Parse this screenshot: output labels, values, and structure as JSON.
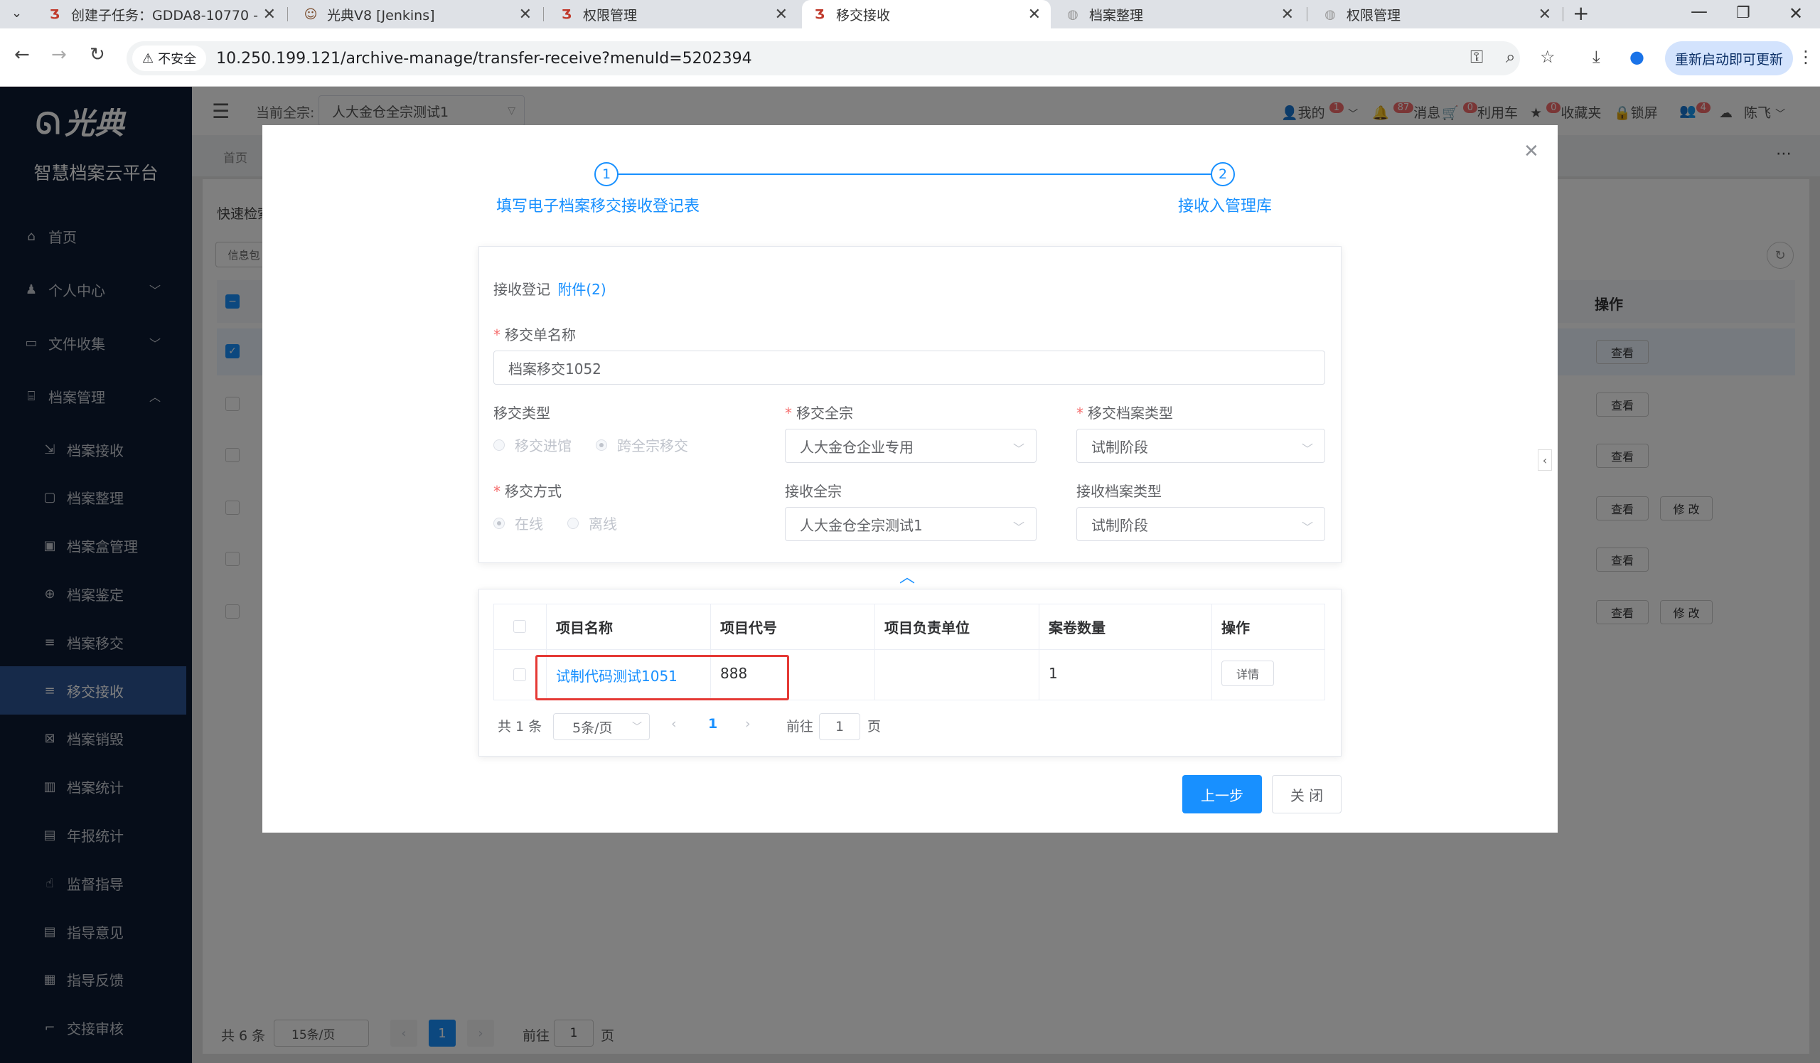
{
  "browser": {
    "tabs": [
      {
        "title": "创建子任务：GDDA8-10770 -",
        "icon": "lightning-icon"
      },
      {
        "title": "光典V8 [Jenkins]",
        "icon": "jenkins-icon"
      },
      {
        "title": "权限管理",
        "icon": "lightning-icon"
      },
      {
        "title": "移交接收",
        "icon": "lightning-icon",
        "active": true
      },
      {
        "title": "档案整理",
        "icon": "globe-icon"
      },
      {
        "title": "权限管理",
        "icon": "globe-icon"
      }
    ],
    "security_label": "不安全",
    "url": "10.250.199.121/archive-manage/transfer-receive?menuId=5202394",
    "relaunch_label": "重新启动即可更新"
  },
  "sidebar": {
    "logo": "光典",
    "platform": "智慧档案云平台",
    "items": [
      {
        "label": "首页",
        "icon": "home-icon",
        "level": "top"
      },
      {
        "label": "个人中心",
        "icon": "user-icon",
        "level": "top",
        "chevron": "﹀"
      },
      {
        "label": "文件收集",
        "icon": "briefcase-icon",
        "level": "top",
        "chevron": "﹀"
      },
      {
        "label": "档案管理",
        "icon": "bank-icon",
        "level": "top",
        "chevron": "︿"
      },
      {
        "label": "档案接收",
        "icon": "import-icon",
        "level": "sub"
      },
      {
        "label": "档案整理",
        "icon": "folder-icon",
        "level": "sub"
      },
      {
        "label": "档案盒管理",
        "icon": "box-icon",
        "level": "sub"
      },
      {
        "label": "档案鉴定",
        "icon": "target-icon",
        "level": "sub"
      },
      {
        "label": "档案移交",
        "icon": "list-icon",
        "level": "sub"
      },
      {
        "label": "移交接收",
        "icon": "list-icon",
        "level": "sub",
        "active": true
      },
      {
        "label": "档案销毁",
        "icon": "destroy-icon",
        "level": "sub"
      },
      {
        "label": "档案统计",
        "icon": "chart-icon",
        "level": "sub"
      },
      {
        "label": "年报统计",
        "icon": "report-icon",
        "level": "sub"
      },
      {
        "label": "监督指导",
        "icon": "hand-icon",
        "level": "sub"
      },
      {
        "label": "指导意见",
        "icon": "comment-icon",
        "level": "sub"
      },
      {
        "label": "指导反馈",
        "icon": "feedback-icon",
        "level": "sub"
      },
      {
        "label": "交接审核",
        "icon": "crop-icon",
        "level": "sub"
      }
    ]
  },
  "header": {
    "current_label": "当前全宗:",
    "current_value": "人大金仓全宗测试1",
    "my_label": "我的",
    "my_badge": "1",
    "msg_label": "消息",
    "msg_badge": "87",
    "cart_label": "利用车",
    "cart_badge": "0",
    "fav_label": "收藏夹",
    "fav_badge": "0",
    "lock_label": "锁屏",
    "user_badge": "4",
    "user_name": "陈飞"
  },
  "background_page": {
    "breadcrumb": "首页",
    "quick_search": "快速检索",
    "tag": "信息包",
    "ops_header": "操作",
    "rows": [
      {
        "view": "查看",
        "edit": ""
      },
      {
        "view": "查看",
        "edit": ""
      },
      {
        "view": "查看",
        "edit": ""
      },
      {
        "view": "查看",
        "edit": "修 改"
      },
      {
        "view": "查看",
        "edit": ""
      },
      {
        "view": "查看",
        "edit": "修 改"
      }
    ],
    "pager": {
      "total": "共 6 条",
      "size": "15条/页",
      "page": "1",
      "goto_label": "前往",
      "goto_value": "1",
      "page_suffix": "页"
    }
  },
  "dialog": {
    "steps": [
      {
        "num": "1",
        "title": "填写电子档案移交接收登记表"
      },
      {
        "num": "2",
        "title": "接收入管理库"
      }
    ],
    "form": {
      "section_title": "接收登记",
      "attachment_link": "附件(2)",
      "name_label": "移交单名称",
      "name_value": "档案移交1052",
      "type_label": "移交类型",
      "type_options": [
        "移交进馆",
        "跨全宗移交"
      ],
      "type_selected": 1,
      "from_fonds_label": "移交全宗",
      "from_fonds_value": "人大金仓企业专用",
      "from_archive_type_label": "移交档案类型",
      "from_archive_type_value": "试制阶段",
      "method_label": "移交方式",
      "method_options": [
        "在线",
        "离线"
      ],
      "method_selected": 0,
      "to_fonds_label": "接收全宗",
      "to_fonds_value": "人大金仓全宗测试1",
      "to_archive_type_label": "接收档案类型",
      "to_archive_type_value": "试制阶段"
    },
    "table": {
      "columns": [
        "项目名称",
        "项目代号",
        "项目负责单位",
        "案卷数量",
        "操作"
      ],
      "rows": [
        {
          "name": "试制代码测试1051",
          "code": "888",
          "unit": "",
          "count": "1",
          "action": "详情"
        }
      ],
      "highlight_color": "#e53935"
    },
    "pager": {
      "total": "共 1 条",
      "size": "5条/页",
      "page": "1",
      "goto_label": "前往",
      "goto_value": "1",
      "page_suffix": "页"
    },
    "buttons": {
      "prev": "上一步",
      "close": "关 闭"
    }
  },
  "colors": {
    "primary": "#1890ff",
    "sidebar_bg": "#0d1b33",
    "sidebar_active": "#2d5595",
    "danger": "#f56c6c"
  }
}
